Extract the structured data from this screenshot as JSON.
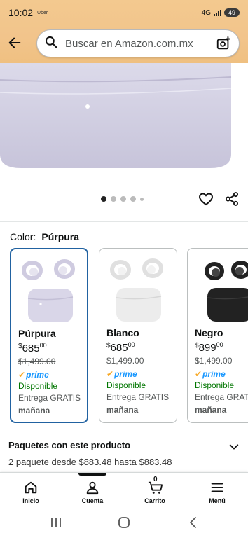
{
  "status": {
    "time": "10:02",
    "carrier": "Uber",
    "network": "4G",
    "battery": "49"
  },
  "header": {
    "search_placeholder": "Buscar en Amazon.com.mx"
  },
  "gallery": {
    "dots_total": 5,
    "active_index": 0
  },
  "color": {
    "label": "Color:",
    "selected": "Púrpura"
  },
  "variants": [
    {
      "name": "Púrpura",
      "currency": "$",
      "price": "685",
      "cents": "00",
      "old_price": "$1,499.00",
      "prime": "prime",
      "availability": "Disponible",
      "shipping": "Entrega GRATIS",
      "when": "mañana",
      "tone": "#d9d6e8"
    },
    {
      "name": "Blanco",
      "currency": "$",
      "price": "685",
      "cents": "00",
      "old_price": "$1,499.00",
      "prime": "prime",
      "availability": "Disponible",
      "shipping": "Entrega GRATIS",
      "when": "mañana",
      "tone": "#ececec"
    },
    {
      "name": "Negro",
      "currency": "$",
      "price": "899",
      "cents": "00",
      "old_price": "$1,499.00",
      "prime": "prime",
      "availability": "Disponible",
      "shipping": "Entrega GRATIS",
      "when": "mañana",
      "tone": "#222222"
    }
  ],
  "bundle": {
    "title": "Paquetes con este producto",
    "subtitle": "2 paquete desde $883.48 hasta $883.48"
  },
  "nav": {
    "items": [
      {
        "label": "Inicio",
        "icon": "home-icon"
      },
      {
        "label": "Cuenta",
        "icon": "account-icon"
      },
      {
        "label": "Carrito",
        "icon": "cart-icon",
        "badge": "0"
      },
      {
        "label": "Menú",
        "icon": "menu-icon"
      }
    ]
  },
  "colors": {
    "accent_blue": "#2162a1",
    "available_green": "#007600",
    "prime_blue": "#1a98ff"
  }
}
